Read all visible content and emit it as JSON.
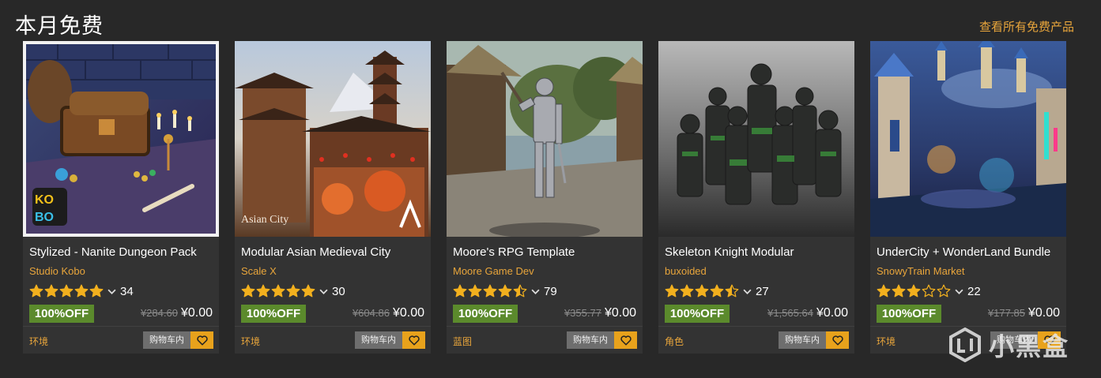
{
  "header": {
    "title": "本月免费",
    "view_all": "查看所有免费产品"
  },
  "buttons": {
    "cart": "购物车内"
  },
  "icons": {
    "star": "star-icon",
    "chevron": "chevron-down-icon",
    "wishlist": "heart-icon",
    "logo": "kobo-logo",
    "brand": "a-logo-icon"
  },
  "colors": {
    "accent": "#e8a53b",
    "discount": "#5b8a2c",
    "wishlist": "#e8a21c"
  },
  "products": [
    {
      "title": "Stylized - Nanite Dungeon Pack",
      "seller": "Studio Kobo",
      "rating": 5,
      "review_count": "34",
      "discount": "100%OFF",
      "old_price": "¥284.60",
      "price": "¥0.00",
      "category": "环境",
      "logo_text": [
        "KO",
        "BO"
      ]
    },
    {
      "title": "Modular Asian Medieval City",
      "seller": "Scale X",
      "rating": 5,
      "review_count": "30",
      "discount": "100%OFF",
      "old_price": "¥604.86",
      "price": "¥0.00",
      "category": "环境",
      "image_caption": "Asian City"
    },
    {
      "title": "Moore's RPG Template",
      "seller": "Moore Game Dev",
      "rating": 4.5,
      "review_count": "79",
      "discount": "100%OFF",
      "old_price": "¥355.77",
      "price": "¥0.00",
      "category": "蓝图"
    },
    {
      "title": "Skeleton Knight Modular",
      "seller": "buxoided",
      "rating": 4.5,
      "review_count": "27",
      "discount": "100%OFF",
      "old_price": "¥1,565.64",
      "price": "¥0.00",
      "category": "角色"
    },
    {
      "title": "UnderCity + WonderLand Bundle",
      "seller": "SnowyTrain Market",
      "rating": 3,
      "review_count": "22",
      "discount": "100%OFF",
      "old_price": "¥177.85",
      "price": "¥0.00",
      "category": "环境"
    }
  ],
  "watermark": {
    "text": "小黑盒"
  }
}
